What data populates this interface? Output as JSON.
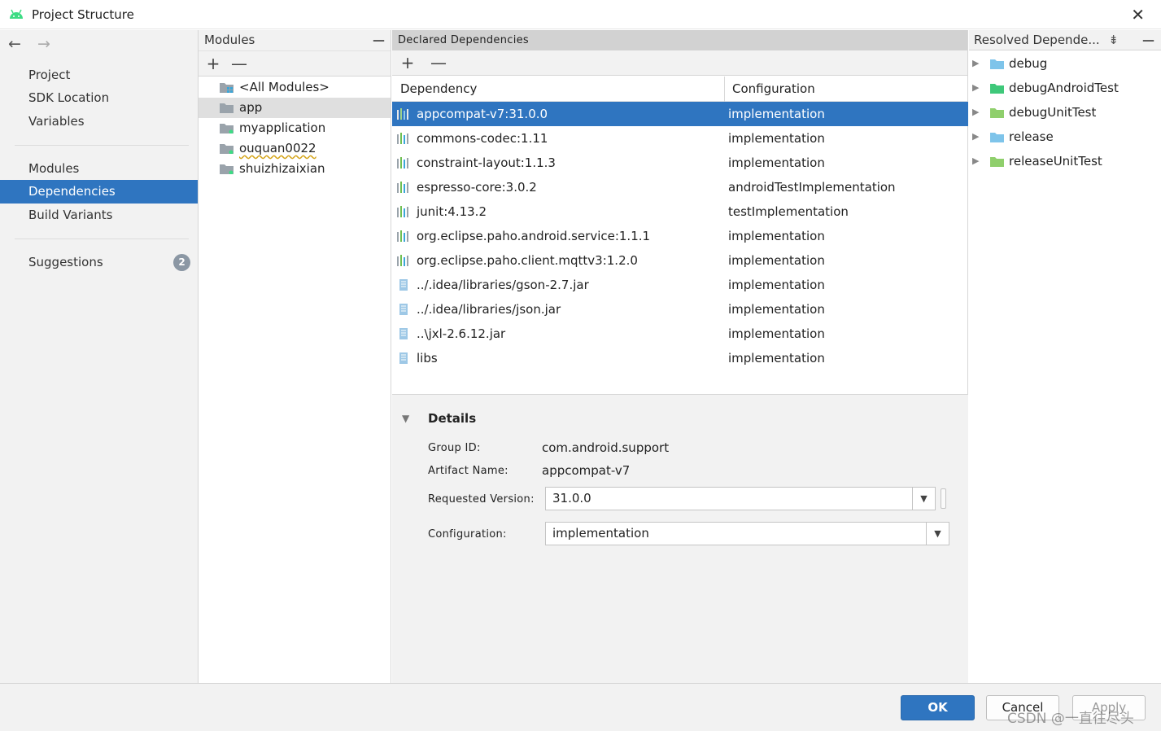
{
  "window": {
    "title": "Project Structure",
    "close_glyph": "✕",
    "icon": "android-icon"
  },
  "nav": {
    "back_glyph": "←",
    "forward_glyph": "→",
    "items": [
      {
        "label": "Project"
      },
      {
        "label": "SDK Location"
      },
      {
        "label": "Variables"
      },
      {
        "label": "Modules"
      },
      {
        "label": "Dependencies",
        "selected": true
      },
      {
        "label": "Build Variants"
      },
      {
        "label": "Suggestions",
        "badge": "2"
      }
    ]
  },
  "modules": {
    "header": "Modules",
    "minimize_glyph": "—",
    "add_glyph": "+",
    "remove_glyph": "—",
    "items": [
      {
        "label": "<All Modules>"
      },
      {
        "label": "app",
        "selected": true
      },
      {
        "label": "myapplication"
      },
      {
        "label": "ouquan0022"
      },
      {
        "label": "shuizhizaixian"
      }
    ]
  },
  "deps": {
    "header": "Declared Dependencies",
    "add_glyph": "+",
    "remove_glyph": "—",
    "col_dependency": "Dependency",
    "col_configuration": "Configuration",
    "rows": [
      {
        "name": "appcompat-v7:31.0.0",
        "config": "implementation",
        "selected": true,
        "icon": "library-icon"
      },
      {
        "name": "commons-codec:1.11",
        "config": "implementation",
        "icon": "library-icon"
      },
      {
        "name": "constraint-layout:1.1.3",
        "config": "implementation",
        "icon": "library-icon"
      },
      {
        "name": "espresso-core:3.0.2",
        "config": "androidTestImplementation",
        "icon": "library-icon"
      },
      {
        "name": "junit:4.13.2",
        "config": "testImplementation",
        "icon": "library-icon"
      },
      {
        "name": "org.eclipse.paho.android.service:1.1.1",
        "config": "implementation",
        "icon": "library-icon"
      },
      {
        "name": "org.eclipse.paho.client.mqttv3:1.2.0",
        "config": "implementation",
        "icon": "library-icon"
      },
      {
        "name": "../.idea/libraries/gson-2.7.jar",
        "config": "implementation",
        "icon": "jar-icon"
      },
      {
        "name": "../.idea/libraries/json.jar",
        "config": "implementation",
        "icon": "jar-icon"
      },
      {
        "name": "..\\jxl-2.6.12.jar",
        "config": "implementation",
        "icon": "jar-icon"
      },
      {
        "name": "libs",
        "config": "implementation",
        "icon": "jar-icon"
      }
    ]
  },
  "details": {
    "title": "Details",
    "expand_glyph": "▼",
    "group_id_label": "Group ID:",
    "group_id": "com.android.support",
    "artifact_label": "Artifact Name:",
    "artifact": "appcompat-v7",
    "version_label": "Requested Version:",
    "version": "31.0.0",
    "config_label": "Configuration:",
    "config": "implementation",
    "dropdown_glyph": "▼"
  },
  "resolved": {
    "header": "Resolved Depende...",
    "collapse_glyph": "⇟",
    "minimize_glyph": "—",
    "chevron_glyph": "▶",
    "items": [
      {
        "label": "debug",
        "color": "#7ec4ea"
      },
      {
        "label": "debugAndroidTest",
        "color": "#3fc87a"
      },
      {
        "label": "debugUnitTest",
        "color": "#8fcf6c"
      },
      {
        "label": "release",
        "color": "#7ec4ea"
      },
      {
        "label": "releaseUnitTest",
        "color": "#8fcf6c"
      }
    ]
  },
  "footer": {
    "ok_label": "OK",
    "cancel_label": "Cancel",
    "apply_label": "Apply",
    "watermark": "CSDN @一直往尽头"
  },
  "colors": {
    "accent": "#2f75c0",
    "android_green": "#3ddc84",
    "panel_bg": "#f2f2f2"
  }
}
